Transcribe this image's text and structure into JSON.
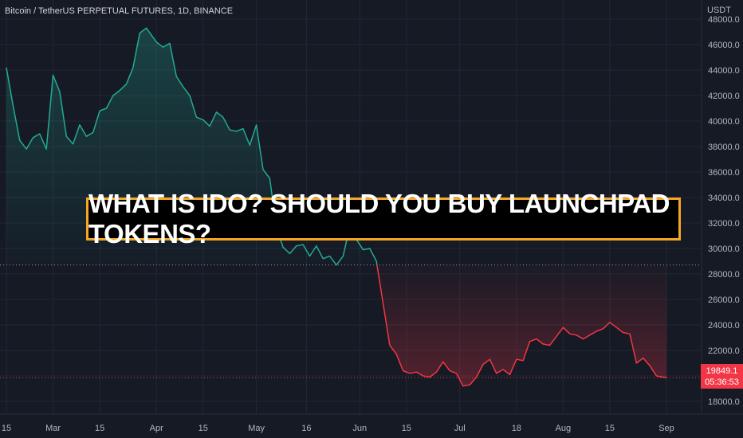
{
  "header": {
    "symbol_label": "Bitcoin / TetherUS PERPETUAL FUTURES, 1D, BINANCE"
  },
  "headline": "WHAT IS IDO? SHOULD YOU BUY LAUNCHPAD TOKENS?",
  "price_tag": {
    "price": "19849.1",
    "countdown": "05:36:53"
  },
  "colors": {
    "background": "#161a25",
    "up": "#22ab94",
    "down": "#f23645",
    "accent": "#f5a623"
  },
  "chart_data": {
    "type": "area",
    "currency_label": "USDT",
    "ylim": [
      17000,
      49500
    ],
    "y_ticks": [
      18000,
      20000,
      22000,
      24000,
      26000,
      28000,
      30000,
      32000,
      34000,
      36000,
      38000,
      40000,
      42000,
      44000,
      46000,
      48000
    ],
    "y_tick_labels": [
      "18000.0",
      "20000.0",
      "22000.0",
      "24000.0",
      "26000.0",
      "28000.0",
      "30000.0",
      "32000.0",
      "34000.0",
      "36000.0",
      "38000.0",
      "40000.0",
      "42000.0",
      "44000.0",
      "46000.0",
      "48000.0"
    ],
    "x_ticks": [
      "2022-02-15",
      "2022-03-01",
      "2022-03-15",
      "2022-04-01",
      "2022-04-15",
      "2022-05-01",
      "2022-05-16",
      "2022-06-01",
      "2022-06-15",
      "2022-07-01",
      "2022-07-18",
      "2022-08-01",
      "2022-08-15",
      "2022-09-01"
    ],
    "x_tick_labels": [
      "15",
      "Mar",
      "15",
      "Apr",
      "15",
      "May",
      "16",
      "Jun",
      "15",
      "Jul",
      "18",
      "Aug",
      "15",
      "Sep"
    ],
    "xlim": [
      "2022-02-15",
      "2022-09-01"
    ],
    "baseline": 28700,
    "current_price": 19849.1,
    "grid": true,
    "series": [
      {
        "x": [
          "2022-02-15",
          "2022-02-17",
          "2022-02-19",
          "2022-02-21",
          "2022-02-23",
          "2022-02-25",
          "2022-02-27",
          "2022-03-01",
          "2022-03-03",
          "2022-03-05",
          "2022-03-07",
          "2022-03-09",
          "2022-03-11",
          "2022-03-13",
          "2022-03-15",
          "2022-03-17",
          "2022-03-19",
          "2022-03-21",
          "2022-03-23",
          "2022-03-25",
          "2022-03-27",
          "2022-03-29",
          "2022-04-01",
          "2022-04-03",
          "2022-04-05",
          "2022-04-07",
          "2022-04-09",
          "2022-04-11",
          "2022-04-13",
          "2022-04-15",
          "2022-04-17",
          "2022-04-19",
          "2022-04-21",
          "2022-04-23",
          "2022-04-25",
          "2022-04-27",
          "2022-04-29",
          "2022-05-01",
          "2022-05-03",
          "2022-05-05",
          "2022-05-07",
          "2022-05-09",
          "2022-05-11",
          "2022-05-13",
          "2022-05-15",
          "2022-05-17",
          "2022-05-19",
          "2022-05-21",
          "2022-05-23",
          "2022-05-25",
          "2022-05-27",
          "2022-05-29",
          "2022-05-31",
          "2022-06-02",
          "2022-06-04",
          "2022-06-06",
          "2022-06-08",
          "2022-06-10",
          "2022-06-12",
          "2022-06-14",
          "2022-06-16",
          "2022-06-18",
          "2022-06-20",
          "2022-06-22",
          "2022-06-24",
          "2022-06-26",
          "2022-06-28",
          "2022-06-30",
          "2022-07-02",
          "2022-07-04",
          "2022-07-06",
          "2022-07-08",
          "2022-07-10",
          "2022-07-12",
          "2022-07-14",
          "2022-07-16",
          "2022-07-18",
          "2022-07-20",
          "2022-07-22",
          "2022-07-24",
          "2022-07-26",
          "2022-07-28",
          "2022-07-30",
          "2022-08-01",
          "2022-08-03",
          "2022-08-05",
          "2022-08-07",
          "2022-08-09",
          "2022-08-11",
          "2022-08-13",
          "2022-08-15",
          "2022-08-17",
          "2022-08-19",
          "2022-08-21",
          "2022-08-23",
          "2022-08-25",
          "2022-08-27",
          "2022-08-29",
          "2022-08-31",
          "2022-09-01"
        ],
        "values": [
          44200,
          41200,
          38500,
          37800,
          38700,
          39000,
          37800,
          43600,
          42300,
          38800,
          38200,
          39700,
          38800,
          39100,
          40800,
          41000,
          42000,
          42400,
          42900,
          44200,
          46900,
          47300,
          46200,
          45800,
          46100,
          43500,
          42700,
          42000,
          40300,
          40100,
          39600,
          40700,
          40300,
          39300,
          39200,
          39400,
          38100,
          39700,
          36200,
          35500,
          31600,
          30100,
          29600,
          30200,
          30300,
          29400,
          30200,
          29200,
          29400,
          28700,
          29400,
          31700,
          30700,
          29900,
          30000,
          29000,
          25700,
          22400,
          21700,
          20400,
          20200,
          20300,
          20000,
          19900,
          20300,
          21100,
          20400,
          20200,
          19200,
          19300,
          19900,
          20900,
          21300,
          20200,
          20500,
          20100,
          21300,
          21200,
          22700,
          22900,
          22500,
          22400,
          23100,
          23800,
          23300,
          23200,
          22900,
          23200,
          23500,
          23700,
          24200,
          23800,
          23400,
          23300,
          21000,
          21400,
          20800,
          20000,
          19900,
          19849.1
        ]
      }
    ]
  }
}
